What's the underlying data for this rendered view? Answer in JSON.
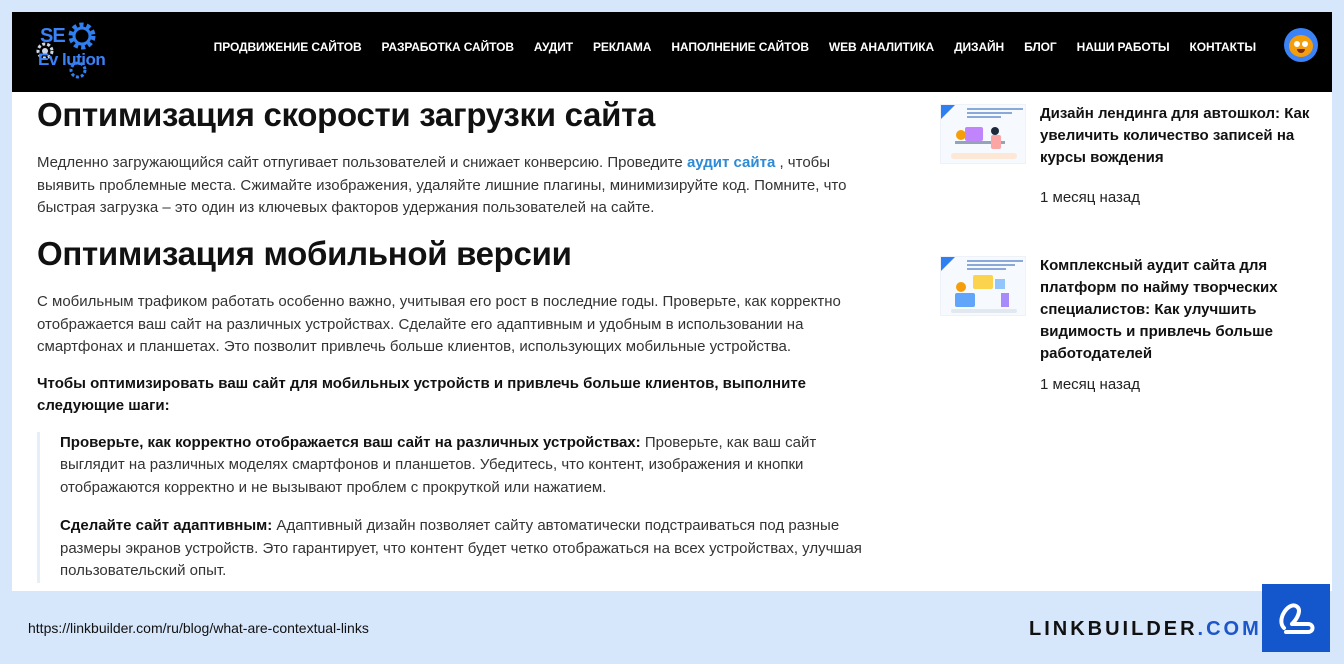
{
  "logo": {
    "line1": "SE",
    "line2": "Ev  lution"
  },
  "nav": {
    "items": [
      "ПРОДВИЖЕНИЕ САЙТОВ",
      "РАЗРАБОТКА САЙТОВ",
      "АУДИТ",
      "РЕКЛАМА",
      "НАПОЛНЕНИЕ САЙТОВ",
      "WEB АНАЛИТИКА",
      "ДИЗАЙН",
      "БЛОГ",
      "НАШИ РАБОТЫ",
      "КОНТАКТЫ"
    ]
  },
  "article": {
    "h_speed": "Оптимизация скорости загрузки сайта",
    "speed_text_1": "Медленно загружающийся сайт отпугивает пользователей и снижает конверсию. Проведите ",
    "speed_link": "аудит сайта",
    "speed_text_2": " , чтобы выявить проблемные места. Сжимайте изображения, удаляйте лишние плагины, минимизируйте код. Помните, что быстрая загрузка – это один из ключевых факторов удержания пользователей на сайте.",
    "h_mobile": "Оптимизация мобильной версии",
    "mobile_text": "С мобильным трафиком работать особенно важно, учитывая его рост в последние годы. Проверьте, как корректно отображается ваш сайт на различных устройствах. Сделайте его адаптивным и удобным в использовании на смартфонах и планшетах. Это позволит привлечь больше клиентов, использующих мобильные устройства.",
    "steps_intro": "Чтобы оптимизировать ваш сайт для мобильных устройств и привлечь больше клиентов, выполните следующие шаги:",
    "steps": [
      {
        "bold": "Проверьте, как корректно отображается ваш сайт на различных устройствах:",
        "text": " Проверьте, как ваш сайт выглядит на различных моделях смартфонов и планшетов. Убедитесь, что контент, изображения и кнопки отображаются корректно и не вызывают проблем с прокруткой или нажатием."
      },
      {
        "bold": "Сделайте сайт адаптивным:",
        "text": " Адаптивный дизайн позволяет сайту автоматически подстраиваться под разные размеры экранов устройств. Это гарантирует, что контент будет четко отображаться на всех устройствах, улучшая пользовательский опыт."
      }
    ]
  },
  "sidebar": {
    "posts": [
      {
        "title": "Дизайн лендинга для автошкол: Как увеличить количество записей на курсы вождения",
        "date": "1 месяц назад"
      },
      {
        "title": "Комплексный аудит сайта для платформ по найму творческих специалистов: Как улучшить видимость и привлечь больше работодателей",
        "date": "1 месяц назад"
      }
    ]
  },
  "footer": {
    "url": "https://linkbuilder.com/ru/blog/what-are-contextual-links",
    "brand_main": "LINKBUILDER",
    "brand_dot": ".COM"
  },
  "colors": {
    "accent": "#2d8ad6",
    "navbar": "#000000",
    "page_bg": "#d6e6fb",
    "brand_blue": "#1456cc"
  }
}
